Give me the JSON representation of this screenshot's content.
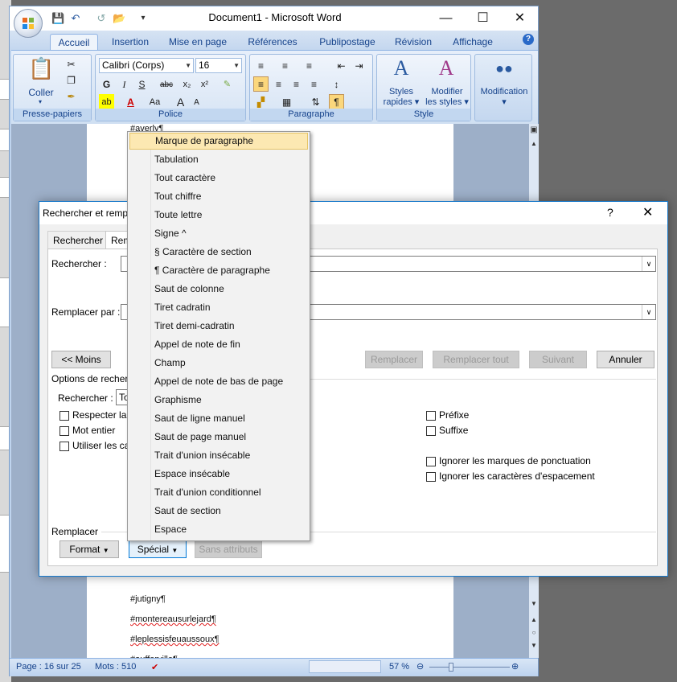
{
  "word": {
    "title": "Document1 - Microsoft Word",
    "tabs": [
      "Accueil",
      "Insertion",
      "Mise en page",
      "Références",
      "Publipostage",
      "Révision",
      "Affichage"
    ],
    "clipboard": {
      "paste_label": "Coller",
      "group_label": "Presse-papiers"
    },
    "font": {
      "name": "Calibri (Corps)",
      "size": "16",
      "group_label": "Police"
    },
    "paragraph": {
      "group_label": "Paragraphe"
    },
    "style": {
      "quick_styles_line1": "Styles",
      "quick_styles_line2": "rapides",
      "change_styles_line1": "Modifier",
      "change_styles_line2": "les styles",
      "group_label": "Style"
    },
    "editing": {
      "label": "Modification"
    },
    "document_lines": [
      "#averly¶",
      "#jutigny¶",
      "#montereausurlejard¶",
      "#leplessisfeuaussoux¶",
      "#aufferville¶"
    ],
    "status": {
      "page": "Page : 16 sur 25",
      "words": "Mots : 510",
      "zoom": "57 %"
    }
  },
  "dialog": {
    "title": "Rechercher et remplacer",
    "help": "?",
    "close": "✕",
    "tabs": {
      "find": "Rechercher",
      "replace": "Remplacer"
    },
    "find_label": "Rechercher :",
    "replace_label": "Remplacer par :",
    "less_button": "<< Moins",
    "replace_button": "Remplacer",
    "replace_all_button": "Remplacer tout",
    "next_button": "Suivant",
    "cancel_button": "Annuler",
    "options_label": "Options de recherche",
    "search_label": "Rechercher :",
    "search_value": "Tout",
    "checkboxes_left": [
      "Respecter la casse",
      "Mot entier",
      "Utiliser les caractères génériques"
    ],
    "checkboxes_right_top": [
      "Préfixe",
      "Suffixe"
    ],
    "checkboxes_right_bottom": [
      "Ignorer les marques de ponctuation",
      "Ignorer les caractères d'espacement"
    ],
    "replace_section_label": "Remplacer",
    "format_button": "Format",
    "special_button": "Spécial",
    "no_format_button": "Sans attributs"
  },
  "special_menu": {
    "items": [
      "Marque de paragraphe",
      "Tabulation",
      "Tout caractère",
      "Tout chiffre",
      "Toute lettre",
      "Signe ^",
      "§ Caractère de section",
      "¶ Caractère de paragraphe",
      "Saut de colonne",
      "Tiret cadratin",
      "Tiret demi-cadratin",
      "Appel de note de fin",
      "Champ",
      "Appel de note de bas de page",
      "Graphisme",
      "Saut de ligne manuel",
      "Saut de page manuel",
      "Trait d'union insécable",
      "Espace insécable",
      "Trait d'union conditionnel",
      "Saut de section",
      "Espace"
    ],
    "highlighted_index": 0
  },
  "colors": {
    "accent": "#15428b",
    "dialog_border": "#1979ca",
    "menu_highlight": "#fce8b2"
  }
}
